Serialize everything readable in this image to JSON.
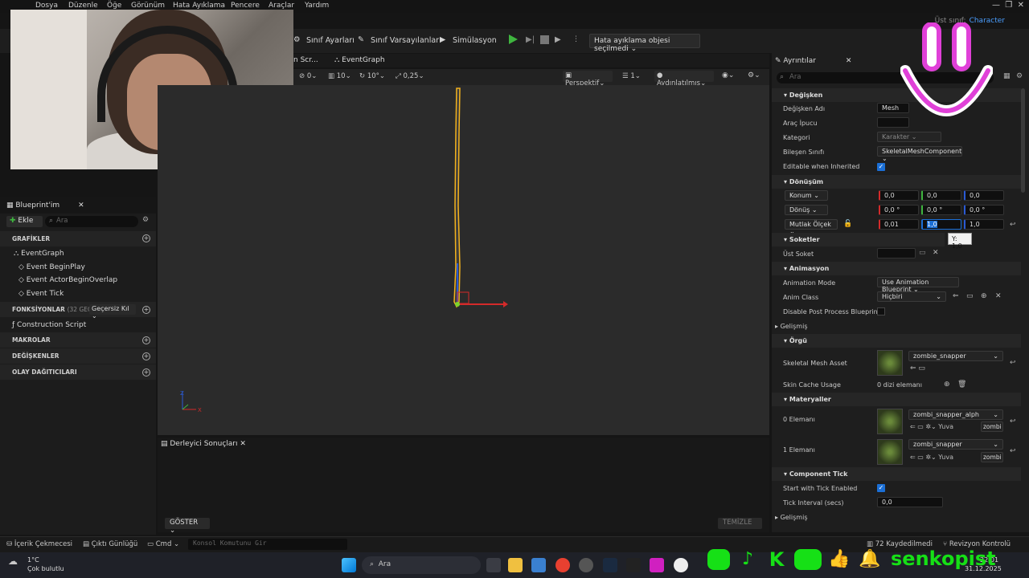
{
  "menu": [
    "Dosya",
    "Düzenle",
    "Öğe",
    "Görünüm",
    "Hata Ayıklama",
    "Pencere",
    "Araçlar",
    "Yardım"
  ],
  "parent_class": {
    "label": "Üst sınıf:",
    "value": "Character"
  },
  "toolbar": {
    "class_settings": "Sınıf Ayarları",
    "class_defaults": "Sınıf Varsayılanları",
    "simulation": "Simülasyon",
    "debug_select": "Hata ayıklama objesi seçilmedi"
  },
  "graph_tabs": [
    "n Scr...",
    "EventGraph"
  ],
  "viewport_toolbar": {
    "snap_grid": "0",
    "grid_size": "10",
    "rot_snap": "10°",
    "scale_snap": "0,25",
    "perspective": "Perspektif",
    "layers": "1",
    "lit": "Aydınlatılmış"
  },
  "blueprint": {
    "tab": "Blueprint'im",
    "add": "Ekle",
    "search_placeholder": "Ara",
    "graphs_header": "GRAFİKLER",
    "event_graph": "EventGraph",
    "events": [
      "Event BeginPlay",
      "Event ActorBeginOverlap",
      "Event Tick"
    ],
    "functions_header": "FONKSİYONLAR",
    "functions_count": "(32 GEÇERSİ",
    "override": "Geçersiz Kıl",
    "construction": "Construction Script",
    "macros": "MAKROLAR",
    "variables": "DEĞİŞKENLER",
    "dispatchers": "OLAY DAĞITICILARI"
  },
  "compiler": {
    "tab": "Derleyici Sonuçları",
    "show": "GÖSTER",
    "clear": "TEMİZLE"
  },
  "details": {
    "tab": "Ayrıntılar",
    "search_placeholder": "Ara",
    "variable_header": "Değişken",
    "var_name_label": "Değişken Adı",
    "var_name": "Mesh",
    "tooltip_label": "Araç İpucu",
    "category_label": "Kategori",
    "category": "Karakter",
    "component_class_label": "Bileşen Sınıfı",
    "component_class": "SkeletalMeshComponent",
    "editable_inherited": "Editable when Inherited",
    "transform_header": "Dönüşüm",
    "location": "Konum",
    "loc": [
      "0,0",
      "0,0",
      "0,0"
    ],
    "rotation": "Dönüş",
    "rot": [
      "0,0 °",
      "0,0 °",
      "0,0 °"
    ],
    "scale": "Mutlak Ölçek",
    "scl": [
      "0,01",
      "1,0",
      "1,0"
    ],
    "scale_tooltip": "Y: 1,0",
    "sockets_header": "Soketler",
    "parent_socket": "Üst Soket",
    "animation_header": "Animasyon",
    "anim_mode_label": "Animation Mode",
    "anim_mode": "Use Animation Blueprint",
    "anim_class_label": "Anim Class",
    "anim_class": "Hiçbiri",
    "disable_pp": "Disable Post Process Blueprint",
    "advanced": "Gelişmiş",
    "mesh_header": "Örgü",
    "skel_mesh_label": "Skeletal Mesh Asset",
    "skel_mesh": "zombie_snapper",
    "skin_cache_label": "Skin Cache Usage",
    "skin_cache": "0 dizi elemanı",
    "materials_header": "Materyaller",
    "elem0": "0 Elemanı",
    "mat0": "zombi_snapper_alph",
    "elem1": "1 Elemanı",
    "mat1": "zombi_snapper",
    "home": "Yuva",
    "zombi": "zombi",
    "tick_header": "Component Tick",
    "start_tick": "Start with Tick Enabled",
    "tick_interval_label": "Tick Interval (secs)",
    "tick_interval": "0,0",
    "advanced2": "Gelişmiş"
  },
  "statusbar": {
    "content": "İçerik Çekmecesi",
    "output": "Çıktı Günlüğü",
    "cmd": "Cmd",
    "console_placeholder": "Konsol Komutunu Gir",
    "saved": "72 Kaydedilmedi",
    "revision": "Revizyon Kontrolü"
  },
  "taskbar": {
    "weather_temp": "1°C",
    "weather_desc": "Çok bulutlu",
    "search": "Ara",
    "time": "22:01",
    "date": "31.12.2025"
  },
  "overlay": {
    "brand": "senkopist"
  },
  "colors": {
    "accent": "#1b6fd6",
    "brand": "#16e016",
    "play": "#3fb53f",
    "selection": "#f2b21e",
    "smiley": "#e040d8"
  }
}
